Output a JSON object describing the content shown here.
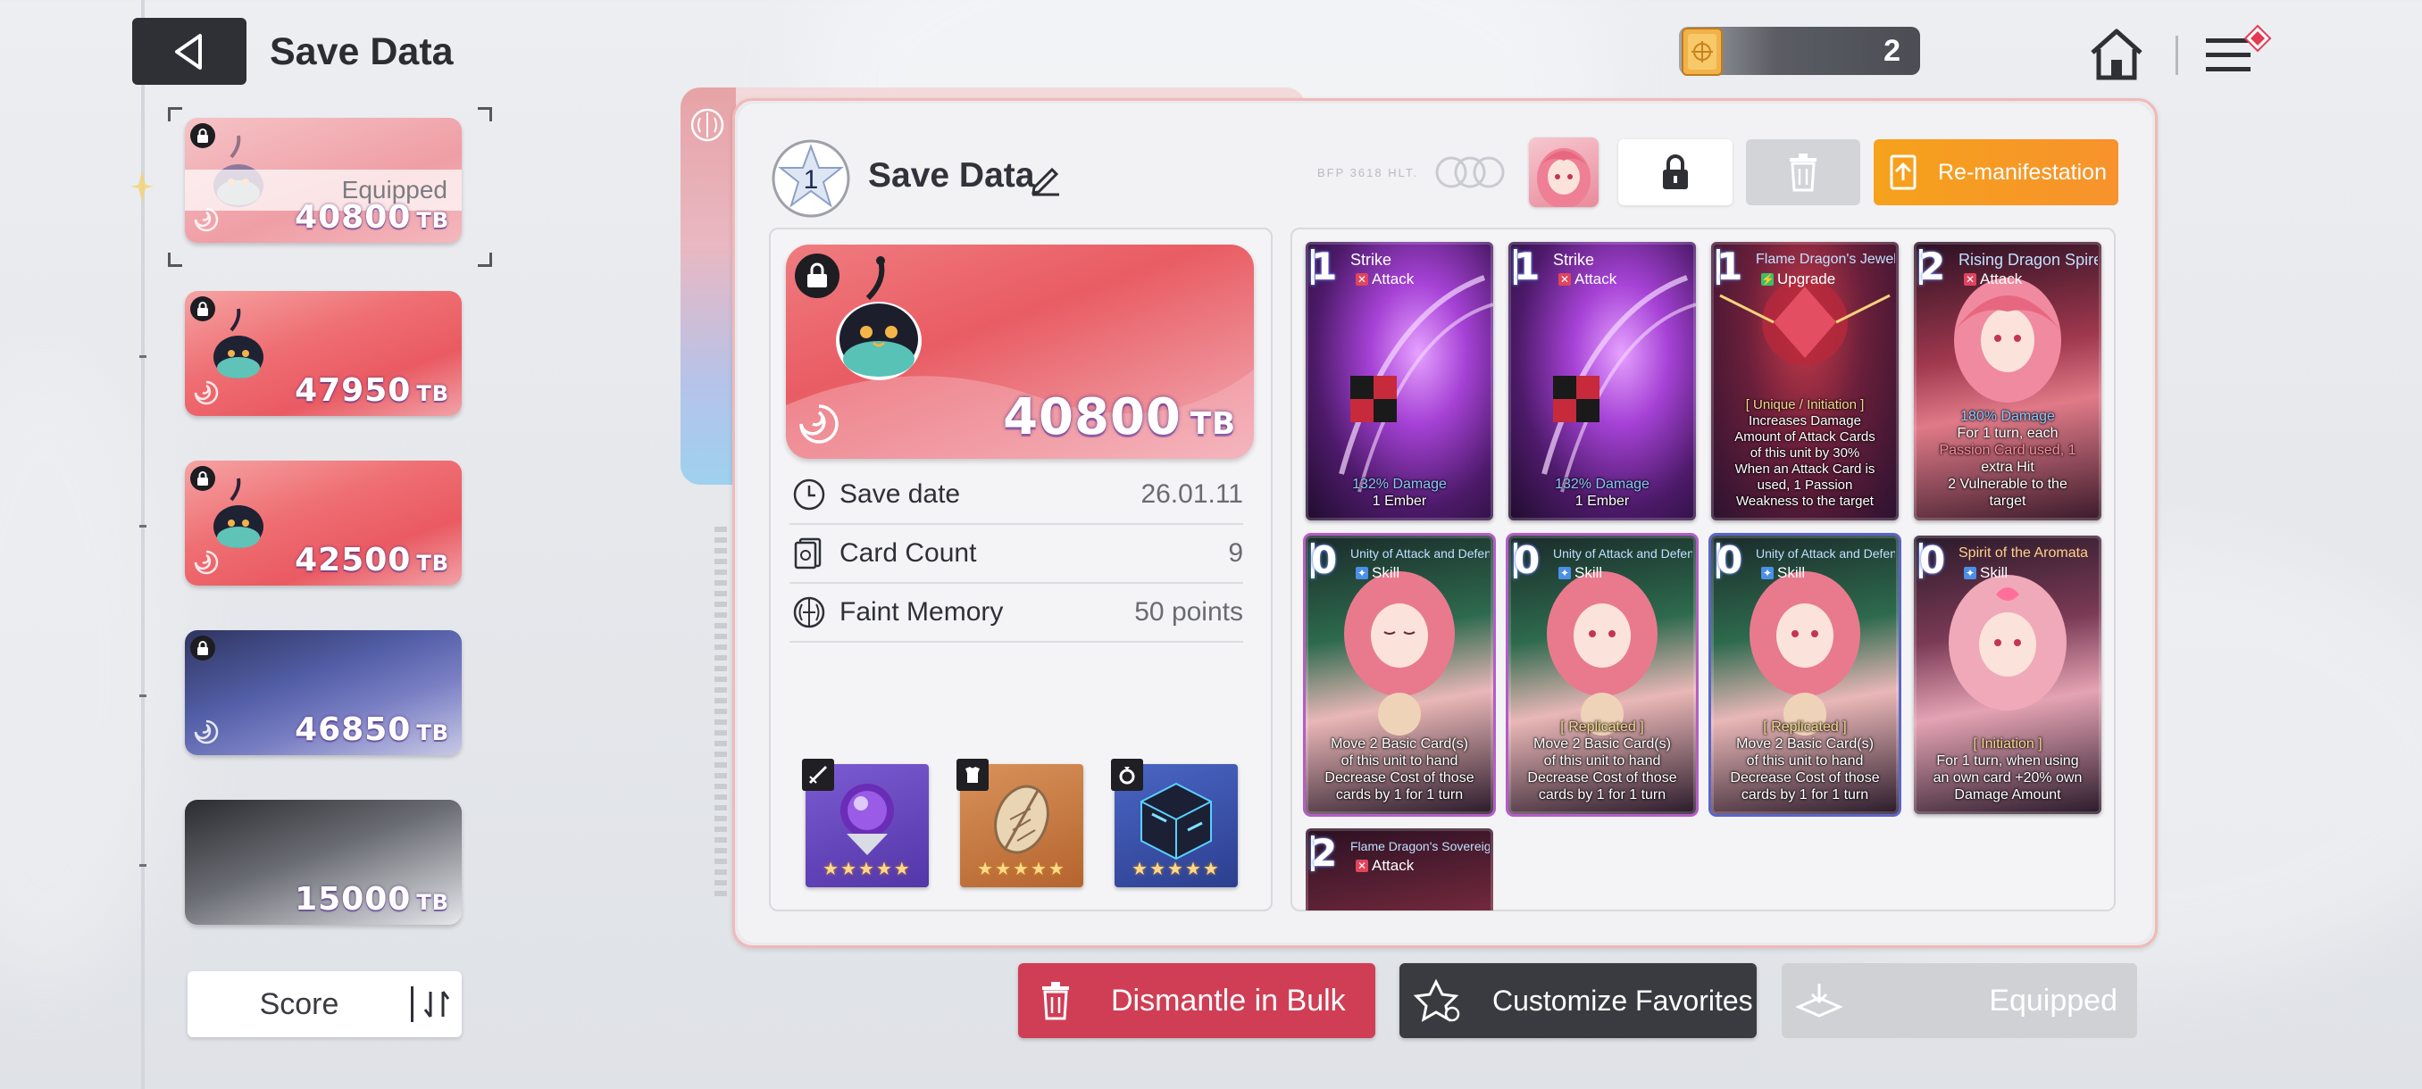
{
  "header": {
    "title": "Save Data",
    "currency_count": "2"
  },
  "slots": [
    {
      "value": "40800",
      "unit": "TB",
      "locked": true,
      "equipped_label": "Equipped",
      "selected": true,
      "style": "pale"
    },
    {
      "value": "47950",
      "unit": "TB",
      "locked": true,
      "style": "red"
    },
    {
      "value": "42500",
      "unit": "TB",
      "locked": true,
      "style": "red"
    },
    {
      "value": "46850",
      "unit": "TB",
      "locked": true,
      "style": "blue"
    },
    {
      "value": "15000",
      "unit": "TB",
      "locked": false,
      "style": "gray"
    }
  ],
  "sort": {
    "label": "Score"
  },
  "panel": {
    "rank": "1",
    "title": "Save Data",
    "deco_text": "BFP 3618 HLT.",
    "remanifest_label": "Re-manifestation",
    "hero": {
      "value": "40800",
      "unit": "TB"
    },
    "info": [
      {
        "key": "Save date",
        "value": "26.01.11",
        "icon": "clock-icon"
      },
      {
        "key": "Card Count",
        "value": "9",
        "icon": "card-count-icon"
      },
      {
        "key": "Faint Memory",
        "value": "50 points",
        "icon": "brain-icon"
      }
    ],
    "equipment": [
      {
        "name": "weapon",
        "tag_icon": "sword-icon",
        "stars": "★★★★★"
      },
      {
        "name": "armor",
        "tag_icon": "armor-icon",
        "stars": "★★★★★"
      },
      {
        "name": "accessory",
        "tag_icon": "ring-icon",
        "stars": "★★★★★"
      }
    ]
  },
  "cards": [
    {
      "cost": "1",
      "name": "Strike",
      "type": "Attack",
      "desc": [
        "132% Damage",
        "1 Ember"
      ]
    },
    {
      "cost": "1",
      "name": "Strike",
      "type": "Attack",
      "desc": [
        "132% Damage",
        "1 Ember"
      ]
    },
    {
      "cost": "1",
      "name": "Flame Dragon's Jewel",
      "type": "Upgrade",
      "desc": [
        "[ Unique / Initiation ]",
        "Increases Damage",
        "Amount of Attack Cards",
        "of this unit by 30%",
        "When an Attack Card is",
        "used, 1 Passion",
        "Weakness to the target"
      ]
    },
    {
      "cost": "2",
      "name": "Rising Dragon Spire",
      "type": "Attack",
      "desc": [
        "180% Damage",
        "For 1 turn, each",
        "Passion Card used, 1",
        "extra Hit",
        "2 Vulnerable to the",
        "target"
      ]
    },
    {
      "cost": "0",
      "name": "Unity of Attack and Defense",
      "type": "Skill",
      "desc": [
        "Move 2 Basic Card(s)",
        "of this unit to hand",
        "Decrease Cost of those",
        "cards by 1 for 1 turn"
      ]
    },
    {
      "cost": "0",
      "name": "Unity of Attack and Defense",
      "type": "Skill",
      "desc": [
        "[ Replicated ]",
        "Move 2 Basic Card(s)",
        "of this unit to hand",
        "Decrease Cost of those",
        "cards by 1 for 1 turn"
      ]
    },
    {
      "cost": "0",
      "name": "Unity of Attack and Defense",
      "type": "Skill",
      "desc": [
        "[ Replicated ]",
        "Move 2 Basic Card(s)",
        "of this unit to hand",
        "Decrease Cost of those",
        "cards by 1 for 1 turn"
      ]
    },
    {
      "cost": "0",
      "name": "Spirit of the Aromata",
      "type": "Skill",
      "desc": [
        "[ Initiation ]",
        "For 1 turn, when using",
        "an own card +20% own",
        "Damage Amount"
      ]
    },
    {
      "cost": "2",
      "name": "Flame Dragon's Sovereignty",
      "type": "Attack",
      "desc": []
    }
  ],
  "buttons": {
    "bulk": "Dismantle in Bulk",
    "favorites": "Customize Favorites",
    "equipped": "Equipped"
  },
  "colors": {
    "attack_tag": "#e2445c",
    "skill_tag": "#4c8fe6",
    "upgrade_tag": "#3bbf6a",
    "accent_orange": "#f6a21c",
    "dismantle_red": "#cf3e55"
  }
}
